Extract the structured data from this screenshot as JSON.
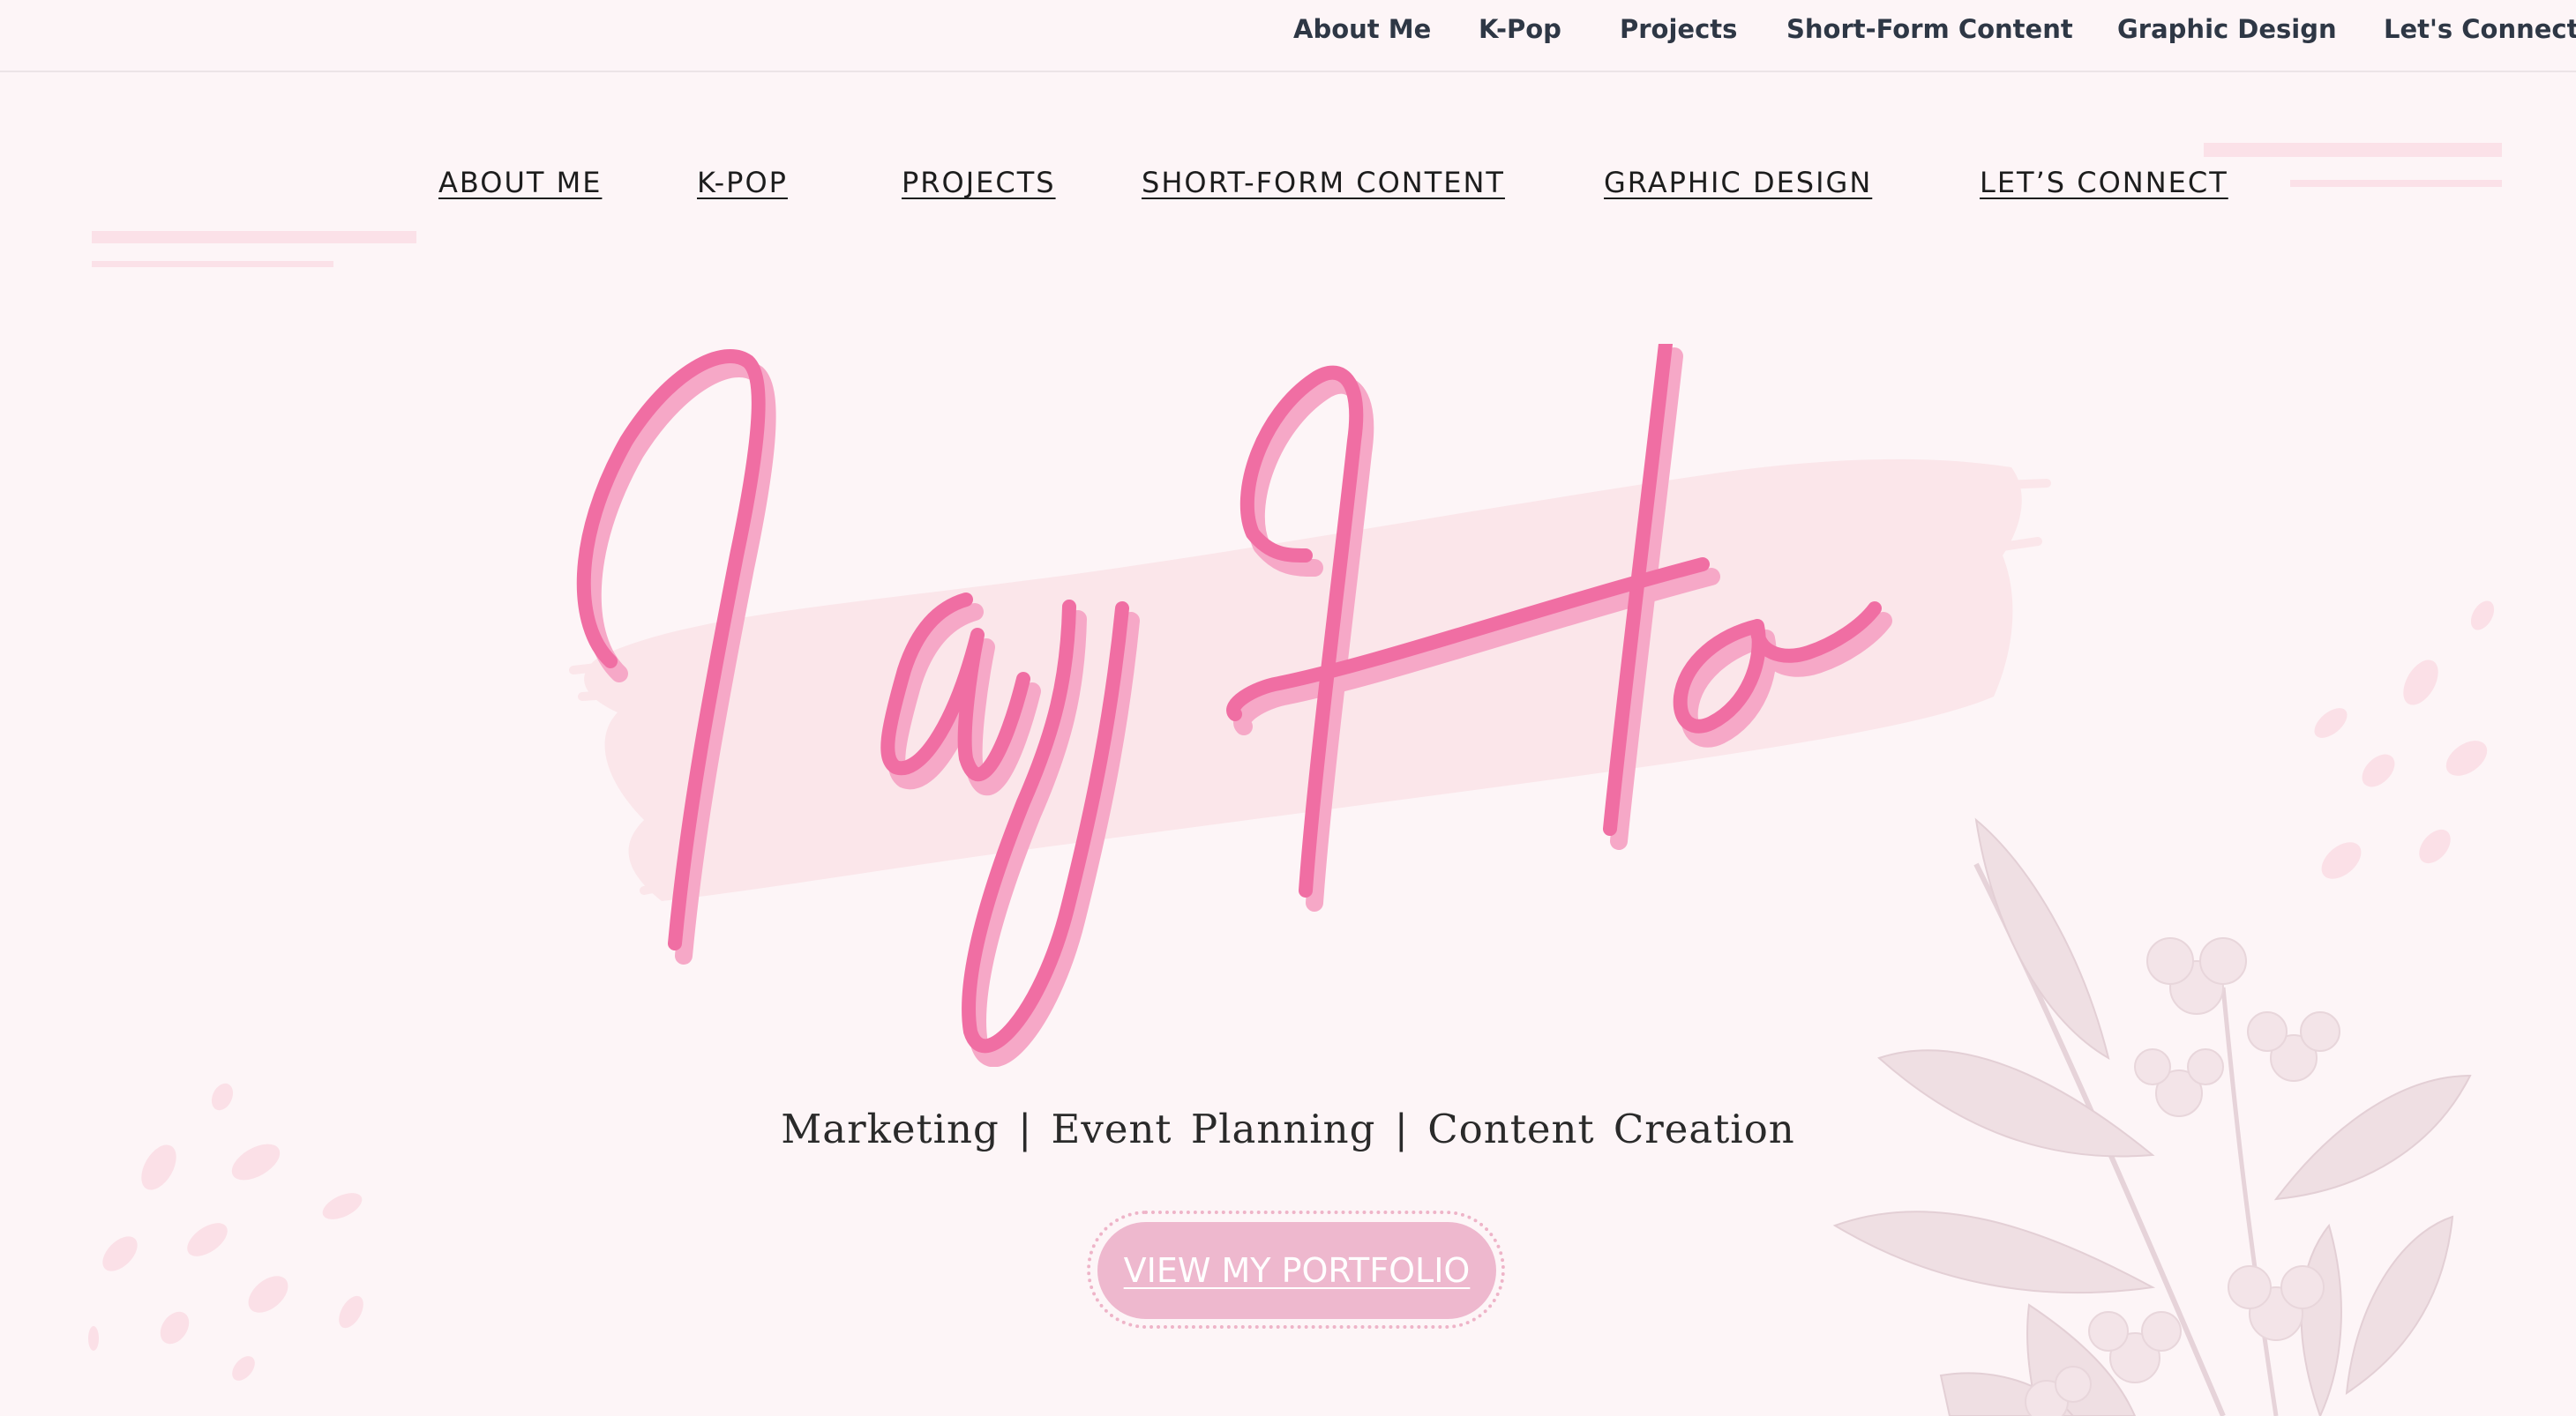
{
  "top_nav": {
    "items": [
      "About Me",
      "K-Pop",
      "Projects",
      "Short-Form Content",
      "Graphic Design",
      "Let's Connect"
    ]
  },
  "hero_nav": {
    "items": [
      "ABOUT ME",
      "K-POP",
      "PROJECTS",
      "SHORT-FORM CONTENT",
      "GRAPHIC DESIGN",
      "LET’S CONNECT"
    ]
  },
  "hero": {
    "name": "Ivy Ho",
    "tagline": "Marketing | Event Planning | Content Creation",
    "cta_label": "VIEW MY PORTFOLIO"
  },
  "colors": {
    "background": "#fdf5f7",
    "brand_pink": "#f06ea3",
    "brush_stroke": "#fbe6ea",
    "button": "#eeb8ce"
  },
  "icons": [
    "floral-illustration",
    "confetti-dots",
    "decorative-lines"
  ]
}
